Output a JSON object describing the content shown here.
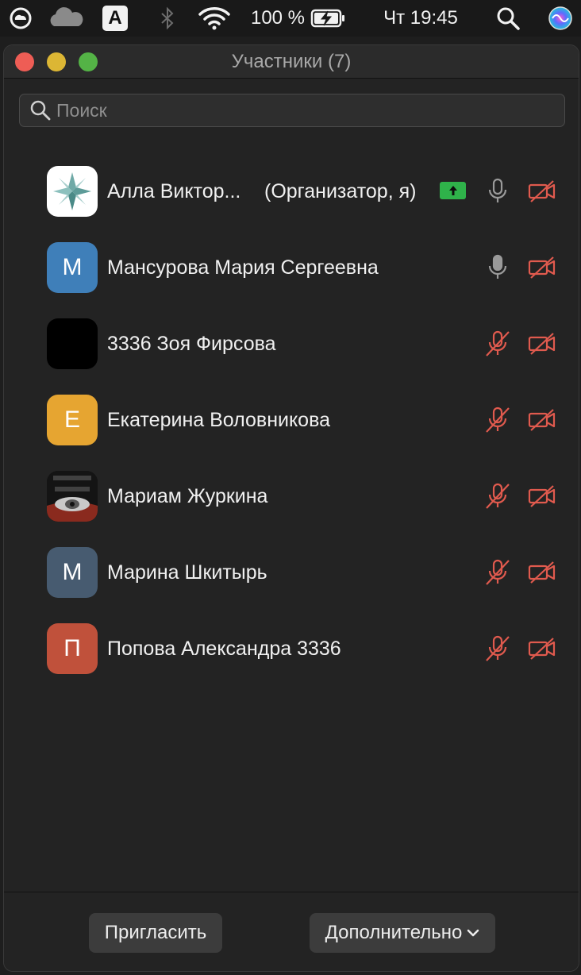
{
  "menubar": {
    "input_source": "A",
    "battery": "100 %",
    "clock": "Чт 19:45"
  },
  "window": {
    "title": "Участники (7)"
  },
  "search": {
    "placeholder": "Поиск"
  },
  "participants": [
    {
      "name": "Алла Виктор...",
      "role": "(Организатор, я)",
      "avatar_type": "logo",
      "avatar_color": "#ffffff",
      "sharing": true,
      "mic": "on",
      "video": "off"
    },
    {
      "name": "Мансурова Мария Сергеевна",
      "initial": "М",
      "avatar_color": "#3f7fb9",
      "mic": "on",
      "video": "off"
    },
    {
      "name": "3336 Зоя Фирсова",
      "avatar_type": "image-black",
      "avatar_color": "#000000",
      "mic": "muted",
      "video": "off"
    },
    {
      "name": "Екатерина Воловникова",
      "initial": "Е",
      "avatar_color": "#e6a531",
      "mic": "muted",
      "video": "off"
    },
    {
      "name": "Мариам Журкина",
      "avatar_type": "photo",
      "avatar_color": "#111111",
      "mic": "muted",
      "video": "off"
    },
    {
      "name": "Марина Шкитырь",
      "initial": "М",
      "avatar_color": "#475b70",
      "mic": "muted",
      "video": "off"
    },
    {
      "name": "Попова Александра 3336",
      "initial": "П",
      "avatar_color": "#c0513b",
      "mic": "muted",
      "video": "off"
    }
  ],
  "footer": {
    "invite_label": "Пригласить",
    "more_label": "Дополнительно"
  },
  "colors": {
    "muted_red": "#e05a4e",
    "mic_gray": "#9a9a9a",
    "share_green": "#2fb24a"
  }
}
